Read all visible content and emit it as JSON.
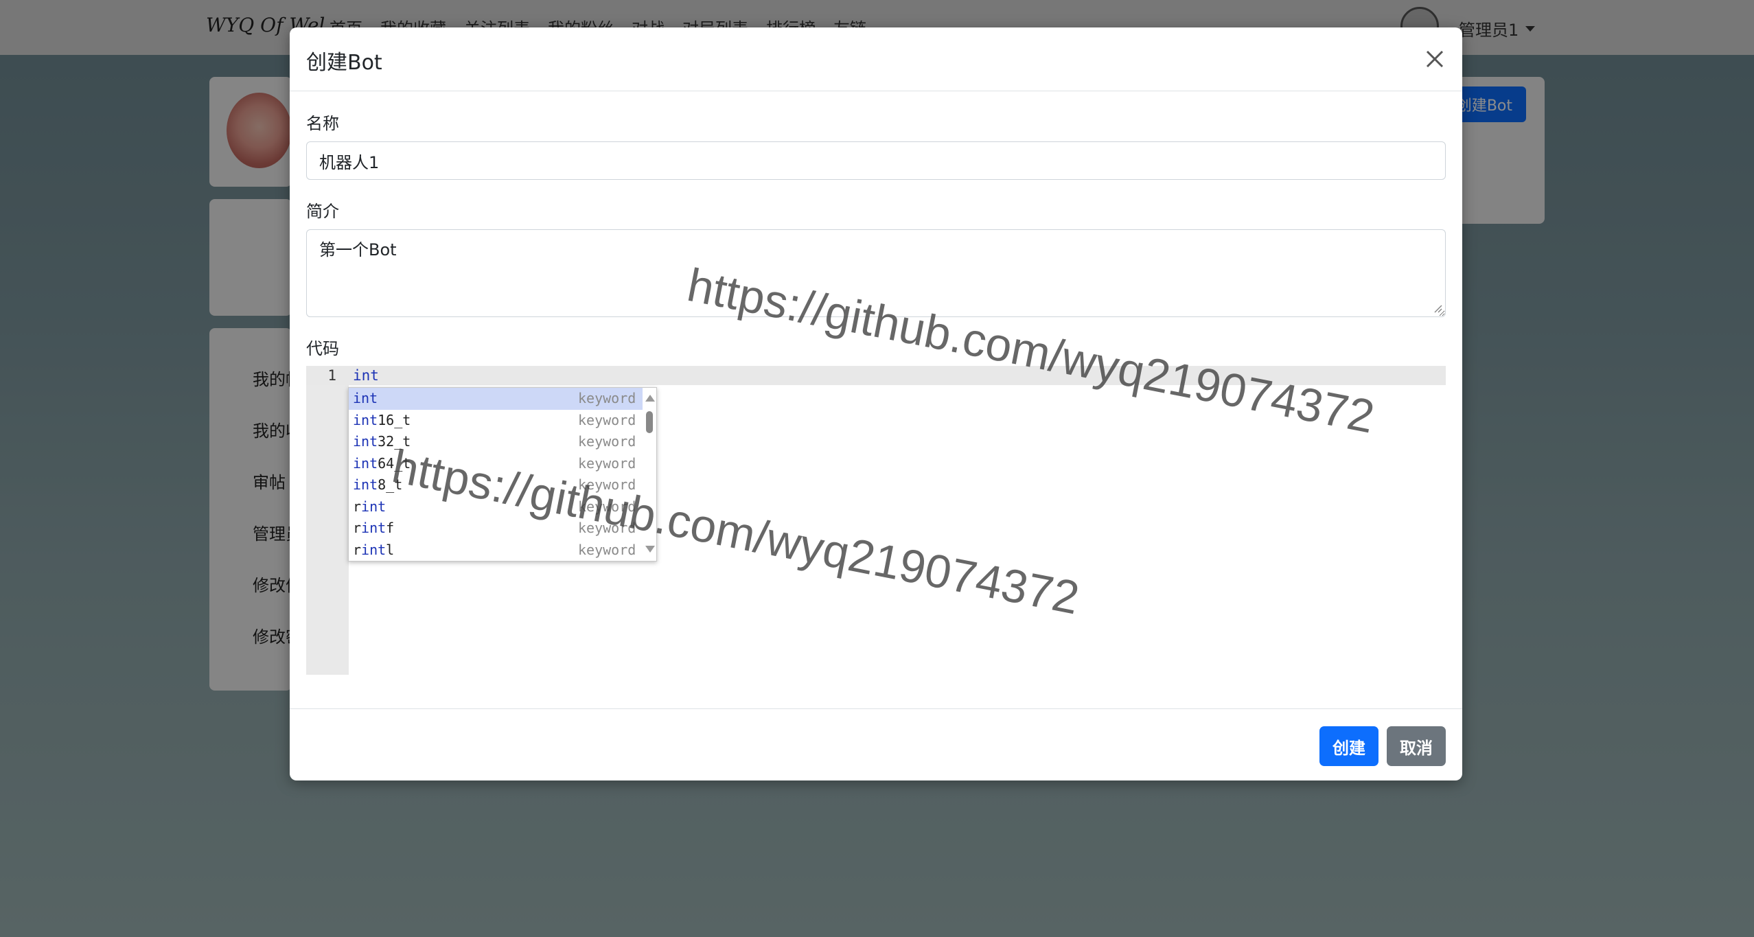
{
  "navbar": {
    "brand": "WYQ Of Wel",
    "items": [
      "首页",
      "我的收藏",
      "关注列表",
      "我的粉丝",
      "对战",
      "对局列表",
      "排行榜",
      "友链"
    ],
    "user_label": "管理员1"
  },
  "sidebar": {
    "items": [
      "我的帖子",
      "我的收藏",
      "审帖",
      "管理员",
      "修改信息",
      "修改密码"
    ]
  },
  "background_button": "创建Bot",
  "modal": {
    "title": "创建Bot",
    "name_label": "名称",
    "name_value": "机器人1",
    "desc_label": "简介",
    "desc_value": "第一个Bot",
    "code_label": "代码",
    "code": {
      "line_number": "1",
      "text": "int"
    },
    "autocomplete": [
      {
        "match": "int",
        "rest": "",
        "prefix": "",
        "kind": "keyword"
      },
      {
        "match": "int",
        "rest": "16_t",
        "prefix": "",
        "kind": "keyword"
      },
      {
        "match": "int",
        "rest": "32_t",
        "prefix": "",
        "kind": "keyword"
      },
      {
        "match": "int",
        "rest": "64_t",
        "prefix": "",
        "kind": "keyword"
      },
      {
        "match": "int",
        "rest": "8_t",
        "prefix": "",
        "kind": "keyword"
      },
      {
        "match": "int",
        "rest": "",
        "prefix": "r",
        "kind": "keyword"
      },
      {
        "match": "int",
        "rest": "f",
        "prefix": "r",
        "kind": "keyword"
      },
      {
        "match": "int",
        "rest": "l",
        "prefix": "r",
        "kind": "keyword"
      }
    ],
    "create_button": "创建",
    "cancel_button": "取消"
  },
  "watermark": "https://github.com/wyq219074372",
  "colors": {
    "primary": "#0d6efd",
    "secondary": "#6c757d",
    "keyword": "#1c33b5",
    "selected_row": "#cdd8f7"
  }
}
